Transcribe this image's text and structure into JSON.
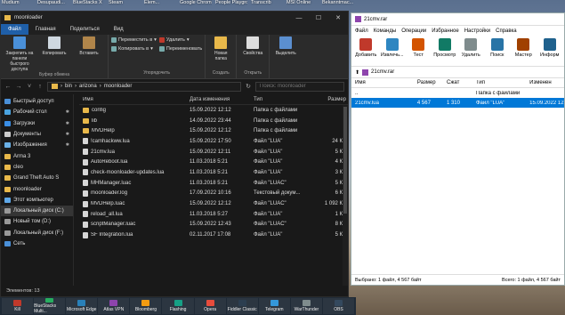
{
  "desktop": {
    "top_labels": [
      "Mudium",
      "Desupaudi...",
      "BlueStacks X",
      "Steam",
      "Elem...",
      "Google Chrome",
      "People Playground",
      "Transcrib",
      "MSI Online",
      "Bekanntmac..."
    ]
  },
  "explorer": {
    "title": "moonloader",
    "tabs": [
      "Файл",
      "Главная",
      "Поделиться",
      "Вид"
    ],
    "ribbon": {
      "pin": "Закрепить на панели быстрого доступа",
      "copy": "Копировать",
      "paste": "Вставить",
      "clipboard_label": "Буфер обмена",
      "move_to": "Переместить в",
      "copy_to": "Копировать в",
      "delete": "Удалить",
      "rename": "Переименовать",
      "organize_label": "Упорядочить",
      "new_folder": "Новая папка",
      "create_label": "Создать",
      "properties": "Свойства",
      "open_label": "Открыть",
      "select": "Выделить"
    },
    "path": [
      "bin",
      "arizona",
      "moonloader"
    ],
    "search_placeholder": "Поиск: moonloader",
    "sidebar": [
      {
        "label": "Быстрый доступ",
        "pin": ""
      },
      {
        "label": "Рабочий стол",
        "pin": "✱"
      },
      {
        "label": "Загрузки",
        "pin": "✱"
      },
      {
        "label": "Документы",
        "pin": "✱"
      },
      {
        "label": "Изображения",
        "pin": "✱"
      },
      {
        "label": "Arma 3",
        "pin": ""
      },
      {
        "label": "cleo",
        "pin": ""
      },
      {
        "label": "Grand Theft Auto S",
        "pin": ""
      },
      {
        "label": "moonloader",
        "pin": ""
      },
      {
        "label": "Этот компьютер",
        "pin": ""
      },
      {
        "label": "Локальный диск (C:)",
        "pin": ""
      },
      {
        "label": "Новый том (D:)",
        "pin": ""
      },
      {
        "label": "Локальный диск (F:)",
        "pin": ""
      },
      {
        "label": "Сеть",
        "pin": ""
      }
    ],
    "columns": {
      "name": "Имя",
      "date": "Дата изменения",
      "type": "Тип",
      "size": "Размер"
    },
    "files": [
      {
        "name": "config",
        "date": "15.09.2022 12:12",
        "type": "Папка с файлами",
        "size": "",
        "kind": "folder"
      },
      {
        "name": "lib",
        "date": "14.09.2022 23:44",
        "type": "Папка с файлами",
        "size": "",
        "kind": "folder"
      },
      {
        "name": "MVDHelp",
        "date": "15.09.2022 12:12",
        "type": "Папка с файлами",
        "size": "",
        "kind": "folder"
      },
      {
        "name": "!camhackww.lua",
        "date": "15.09.2022 17:50",
        "type": "Файл \"LUA\"",
        "size": "24 КБ",
        "kind": "file"
      },
      {
        "name": "21cmv.lua",
        "date": "15.09.2022 12:11",
        "type": "Файл \"LUA\"",
        "size": "5 КБ",
        "kind": "file"
      },
      {
        "name": "AutoReboot.lua",
        "date": "11.03.2018 5:21",
        "type": "Файл \"LUA\"",
        "size": "4 КБ",
        "kind": "file"
      },
      {
        "name": "check-moonloader-updates.lua",
        "date": "11.03.2018 5:21",
        "type": "Файл \"LUA\"",
        "size": "3 КБ",
        "kind": "file"
      },
      {
        "name": "MHManager.luac",
        "date": "11.03.2018 5:21",
        "type": "Файл \"LUAC\"",
        "size": "5 КБ",
        "kind": "file"
      },
      {
        "name": "moonloader.log",
        "date": "17.09.2022 10:16",
        "type": "Текстовый докум...",
        "size": "6 КБ",
        "kind": "file"
      },
      {
        "name": "MVDHelp.luac",
        "date": "15.09.2022 12:12",
        "type": "Файл \"LUAC\"",
        "size": "1 092 КБ",
        "kind": "file"
      },
      {
        "name": "reload_all.lua",
        "date": "11.03.2018 5:27",
        "type": "Файл \"LUA\"",
        "size": "1 КБ",
        "kind": "file"
      },
      {
        "name": "scriptManager.luac",
        "date": "15.09.2022 12:43",
        "type": "Файл \"LUAC\"",
        "size": "8 КБ",
        "kind": "file"
      },
      {
        "name": "SF Integration.lua",
        "date": "02.11.2017 17:08",
        "type": "Файл \"LUA\"",
        "size": "5 КБ",
        "kind": "file"
      }
    ],
    "status": "Элементов: 13"
  },
  "rar": {
    "title": "21cmv.rar",
    "menu": [
      "Файл",
      "Команды",
      "Операции",
      "Избранное",
      "Настройки",
      "Справка"
    ],
    "tools": [
      {
        "label": "Добавить",
        "color": "#c0392b"
      },
      {
        "label": "Извлечь...",
        "color": "#2e86c1"
      },
      {
        "label": "Тест",
        "color": "#d35400"
      },
      {
        "label": "Просмотр",
        "color": "#117a65"
      },
      {
        "label": "Удалить",
        "color": "#7f8c8d"
      },
      {
        "label": "Поиск",
        "color": "#2874a6"
      },
      {
        "label": "Мастер",
        "color": "#a04000"
      },
      {
        "label": "Информ",
        "color": "#1f618d"
      }
    ],
    "path": "21cmv.rar",
    "columns": {
      "name": "Имя",
      "size": "Размер",
      "packed": "Сжат",
      "type": "Тип",
      "modified": "Изменен"
    },
    "rows": [
      {
        "name": "..",
        "size": "",
        "packed": "",
        "type": "Папка с файлами",
        "modified": ""
      },
      {
        "name": "21cmv.lua",
        "size": "4 567",
        "packed": "1 310",
        "type": "Файл \"LUA\"",
        "modified": "15.09.2022 12"
      }
    ],
    "status_left": "Выбрано: 1 файл, 4 567 байт",
    "status_right": "Всего: 1 файл, 4 567 байт"
  },
  "taskbar": [
    "Kill",
    "BlueStacks Multi...",
    "Microsoft Edge",
    "Atlas VPN",
    "Bloomberg",
    "Flashing",
    "Opera",
    "Fiddler Classic",
    "Telegram",
    "WarThunder",
    "OBS"
  ]
}
